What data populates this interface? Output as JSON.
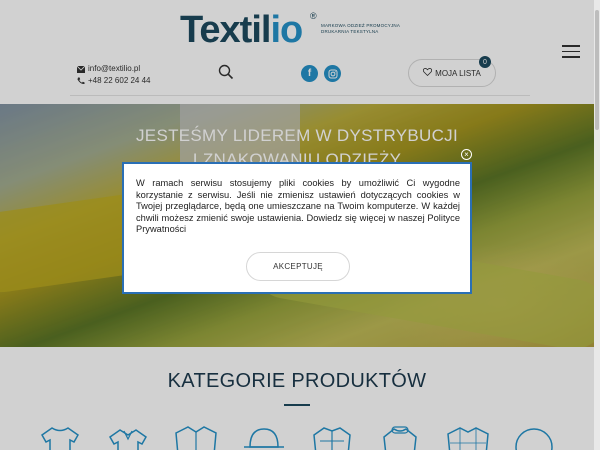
{
  "header": {
    "logo_text_main": "Textil",
    "logo_text_accent": "io",
    "logo_reg": "®",
    "logo_tagline_1": "MARKOWA ODZIEŻ PROMOCYJNA",
    "logo_tagline_2": "DRUKARNIA TEKSTYLNA",
    "email": "info@textilio.pl",
    "phone": "+48 22 602 24 44",
    "social": [
      {
        "icon": "facebook-icon",
        "glyph": "f"
      },
      {
        "icon": "instagram-icon",
        "glyph": "◎"
      }
    ],
    "wishlist_label": "MOJA LISTA",
    "wishlist_count": "0"
  },
  "hero": {
    "title_line_1": "JESTEŚMY LIDEREM W DYSTRYBUCJI",
    "title_line_2": "I ZNAKOWANIU ODZIEŻY"
  },
  "cookie_modal": {
    "text": "W ramach serwisu stosujemy pliki cookies by umożliwić Ci wygodne korzystanie z serwisu. Jeśli nie zmienisz ustawień dotyczących cookies w Twojej przeglądarce, będą one umieszczane na Twoim komputerze. W każdej chwili możesz zmienić swoje ustawienia. Dowiedz się więcej w naszej Polityce Prywatności",
    "accept_label": "AKCEPTUJĘ",
    "close_glyph": "×"
  },
  "categories": {
    "title": "KATEGORIE PRODUKTÓW",
    "icons": [
      "tshirt-icon",
      "polo-shirt-icon",
      "shirt-icon",
      "cap-icon",
      "jacket-icon",
      "sweatshirt-icon",
      "checkered-shirt-icon",
      "ball-icon"
    ]
  },
  "colors": {
    "brand_dark": "#1d4a5e",
    "brand_blue": "#2592c8",
    "modal_border": "#2a6fb5"
  }
}
